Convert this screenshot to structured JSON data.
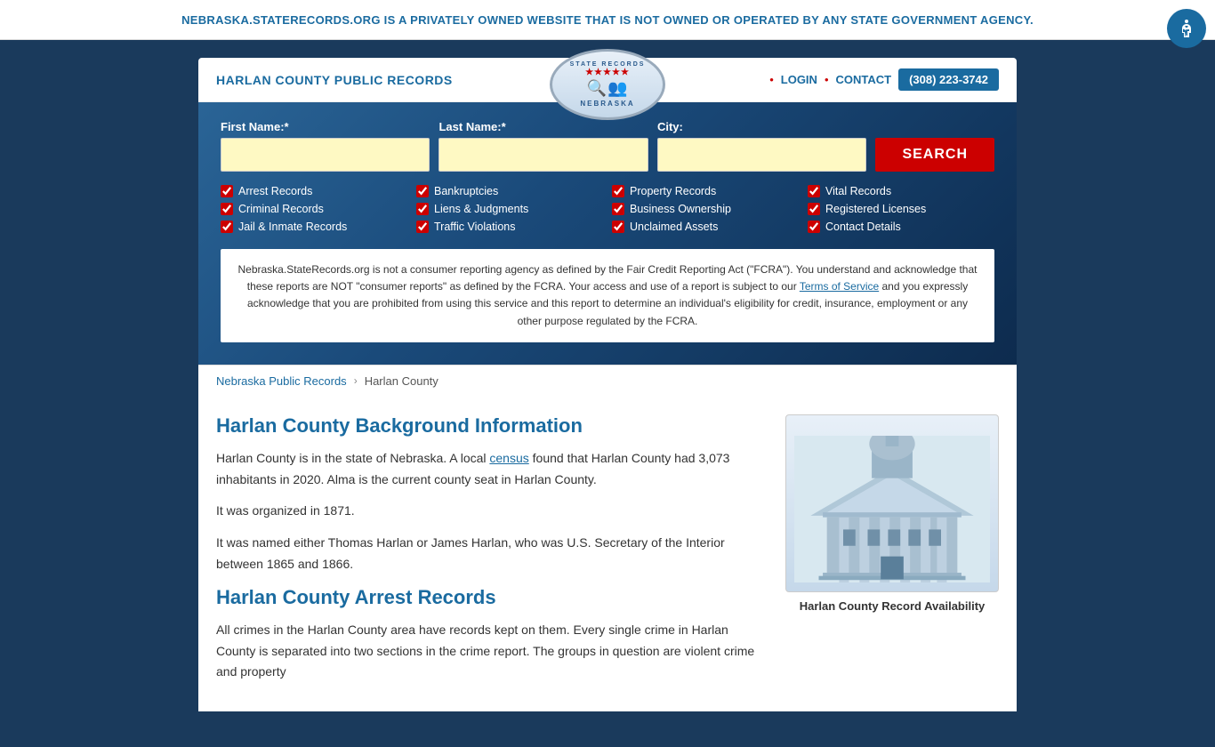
{
  "banner": {
    "text": "NEBRASKA.STATERECORDS.ORG IS A PRIVATELY OWNED WEBSITE THAT IS NOT OWNED OR OPERATED BY ANY STATE GOVERNMENT AGENCY.",
    "close_label": "×"
  },
  "header": {
    "site_title": "HARLAN COUNTY PUBLIC RECORDS",
    "logo": {
      "top_text": "STATE RECORDS",
      "bottom_text": "NEBRASKA"
    },
    "nav": {
      "login_label": "LOGIN",
      "contact_label": "CONTACT",
      "phone": "(308) 223-3742",
      "dot": "•"
    }
  },
  "search": {
    "first_name_label": "First Name:*",
    "last_name_label": "Last Name:*",
    "city_label": "City:",
    "first_name_placeholder": "",
    "last_name_placeholder": "",
    "city_placeholder": "",
    "search_button": "SEARCH",
    "checkboxes": [
      {
        "label": "Arrest Records",
        "checked": true,
        "col": 1
      },
      {
        "label": "Bankruptcies",
        "checked": true,
        "col": 2
      },
      {
        "label": "Property Records",
        "checked": true,
        "col": 3
      },
      {
        "label": "Vital Records",
        "checked": true,
        "col": 4
      },
      {
        "label": "Criminal Records",
        "checked": true,
        "col": 1
      },
      {
        "label": "Liens & Judgments",
        "checked": true,
        "col": 2
      },
      {
        "label": "Business Ownership",
        "checked": true,
        "col": 3
      },
      {
        "label": "Registered Licenses",
        "checked": true,
        "col": 4
      },
      {
        "label": "Jail & Inmate Records",
        "checked": true,
        "col": 1
      },
      {
        "label": "Traffic Violations",
        "checked": true,
        "col": 2
      },
      {
        "label": "Unclaimed Assets",
        "checked": true,
        "col": 3
      },
      {
        "label": "Contact Details",
        "checked": true,
        "col": 4
      }
    ],
    "disclaimer": "Nebraska.StateRecords.org is not a consumer reporting agency as defined by the Fair Credit Reporting Act (\"FCRA\"). You understand and acknowledge that these reports are NOT \"consumer reports\" as defined by the FCRA. Your access and use of a report is subject to our Terms of Service and you expressly acknowledge that you are prohibited from using this service and this report to determine an individual's eligibility for credit, insurance, employment or any other purpose regulated by the FCRA.",
    "terms_link": "Terms of Service"
  },
  "breadcrumb": {
    "parent_label": "Nebraska Public Records",
    "separator": "›",
    "current": "Harlan County"
  },
  "main_content": {
    "section1_title": "Harlan County Background Information",
    "section1_p1": "Harlan County is in the state of Nebraska. A local census found that Harlan County had 3,073 inhabitants in 2020. Alma is the current county seat in Harlan County.",
    "section1_p1_link": "census",
    "section1_p2": "It was organized in 1871.",
    "section1_p3": "It was named either Thomas Harlan or James Harlan, who was U.S. Secretary of the Interior between 1865 and 1866.",
    "section2_title": "Harlan County Arrest Records",
    "section2_p1": "All crimes in the Harlan County area have records kept on them. Every single crime in Harlan County is separated into two sections in the crime report. The groups in question are violent crime and property"
  },
  "sidebar": {
    "caption": "Harlan County Record Availability"
  }
}
